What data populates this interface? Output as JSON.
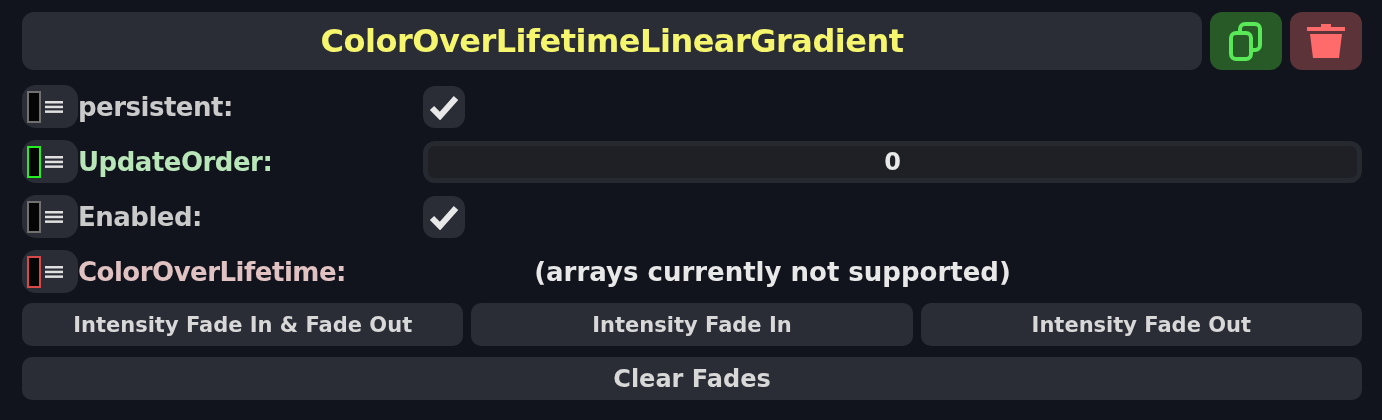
{
  "title": "ColorOverLifetimeLinearGradient",
  "fields": [
    {
      "kind": "checkbox",
      "label": "persistent:",
      "color": "#707070",
      "checked": true
    },
    {
      "kind": "number",
      "label": "UpdateOrder:",
      "color": "#22ee22",
      "value": "0"
    },
    {
      "kind": "checkbox",
      "label": "Enabled:",
      "color": "#707070",
      "checked": true
    },
    {
      "kind": "note",
      "label": "ColorOverLifetime:",
      "color": "#d84848",
      "note": "(arrays currently not supported)"
    }
  ],
  "fade_buttons": [
    "Intensity Fade In & Fade Out",
    "Intensity Fade In",
    "Intensity Fade Out"
  ],
  "clear_button": "Clear Fades"
}
